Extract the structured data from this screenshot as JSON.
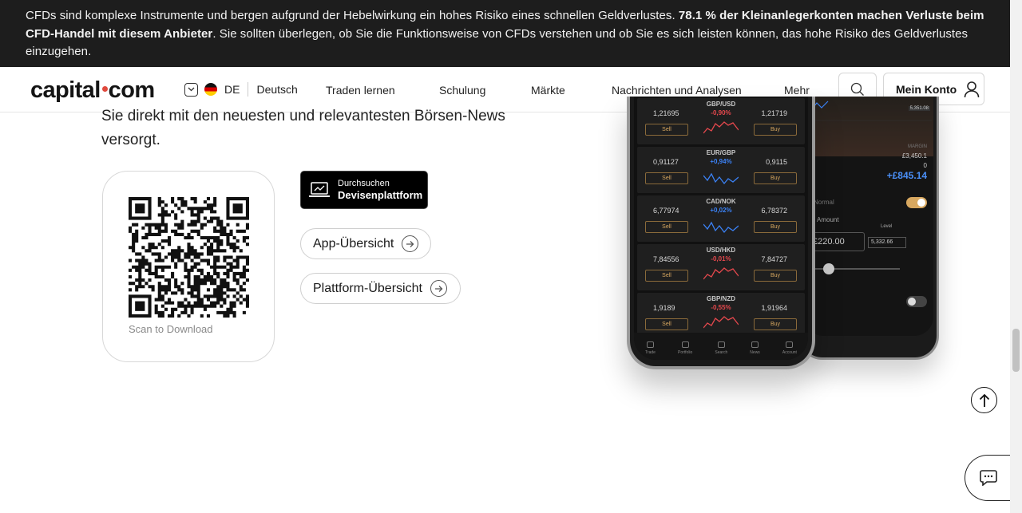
{
  "risk_banner": {
    "text_before": "CFDs sind komplexe Instrumente und bergen aufgrund der Hebelwirkung ein hohes Risiko eines schnellen Geldverlustes. ",
    "text_bold": "78.1 % der Kleinanlegerkonten machen Verluste beim CFD-Handel mit diesem Anbieter",
    "text_after": ". Sie sollten überlegen, ob Sie die Funktionsweise von CFDs verstehen und ob Sie es sich leisten können, das hohe Risiko des Geldverlustes einzugehen."
  },
  "nav": {
    "logo_left": "capital",
    "logo_right": "com",
    "lang_code": "DE",
    "lang_name": "Deutsch",
    "menu": [
      "Traden lernen",
      "Schulung",
      "Märkte",
      "Nachrichten und Analysen",
      "Mehr"
    ],
    "account_label": "Mein Konto",
    "icons": {
      "search": "search-icon",
      "user": "user-icon",
      "flag": "germany-flag-icon",
      "chevron": "chevron-down-icon"
    }
  },
  "content": {
    "intro": "Sie direkt mit den neuesten und relevantesten Börsen-News versorgt.",
    "qr_caption": "Scan to Download",
    "store_small": "Durchsuchen",
    "store_big": "Devisenplattform",
    "app_overview": "App-Übersicht",
    "platform_overview": "Plattform-Übersicht"
  },
  "phone": {
    "pairs": [
      {
        "name": "GBP/USD",
        "change": "-0,90%",
        "sell": "1,21695",
        "buy": "1,21719",
        "trend": "down"
      },
      {
        "name": "EUR/GBP",
        "change": "+0,94%",
        "sell": "0,91127",
        "buy": "0,9115",
        "trend": "up"
      },
      {
        "name": "CAD/NOK",
        "change": "+0,02%",
        "sell": "6,77974",
        "buy": "6,78372",
        "trend": "up"
      },
      {
        "name": "USD/HKD",
        "change": "-0,01%",
        "sell": "7,84556",
        "buy": "7,84727",
        "trend": "down"
      },
      {
        "name": "GBP/NZD",
        "change": "-0,55%",
        "sell": "1,9189",
        "buy": "1,91964",
        "trend": "down"
      }
    ],
    "sell_label": "Sell",
    "buy_label": "Buy",
    "tabs": [
      "Trade",
      "Portfolio",
      "Search",
      "News",
      "Account"
    ],
    "back_screen": {
      "margin_label": "MARGIN",
      "margin_value": "£3,450.1",
      "zero": "0",
      "profit": "+£845.14",
      "order_type": "Normal",
      "amount_label": "Amount",
      "level_label": "Level",
      "amount_value": "£220.00",
      "level_value": "5,332.66",
      "price_tag": "5,351.08"
    },
    "colors": {
      "up": "#3b82f6",
      "down": "#e5484d",
      "accent": "#d8a860"
    }
  },
  "floating": {
    "back_to_top": "arrow-up-icon",
    "chat": "chat-icon"
  }
}
